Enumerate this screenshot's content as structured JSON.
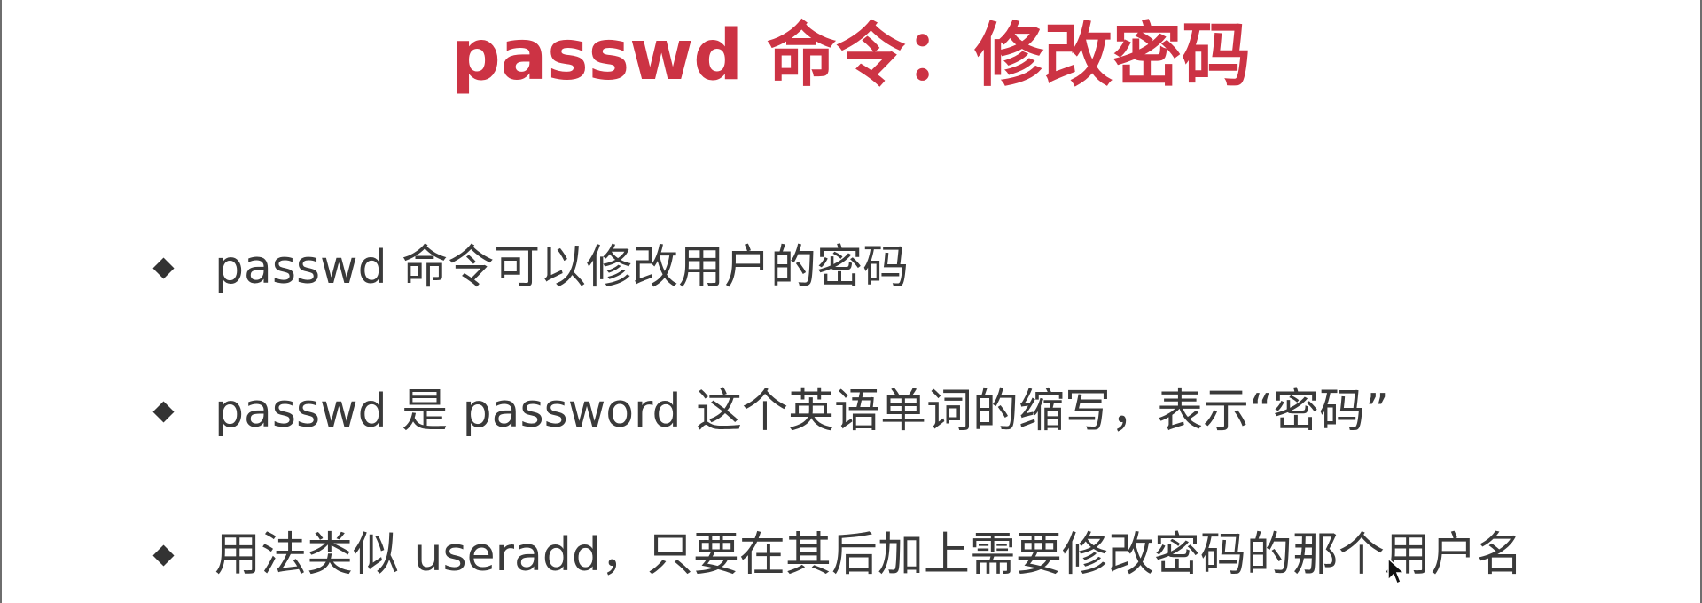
{
  "slide": {
    "title": "passwd 命令：修改密码",
    "bullets": [
      "passwd 命令可以修改用户的密码",
      "passwd 是 password 这个英语单词的缩写，表示“密码”",
      "用法类似 useradd，只要在其后加上需要修改密码的那个用户名"
    ]
  },
  "colors": {
    "title": "#cc3344",
    "body_text": "#3a3a3a",
    "bullet_marker": "#333333",
    "background": "#ffffff"
  },
  "icons": {
    "bullet_marker": "diamond-bullet",
    "cursor": "mouse-pointer-icon"
  }
}
